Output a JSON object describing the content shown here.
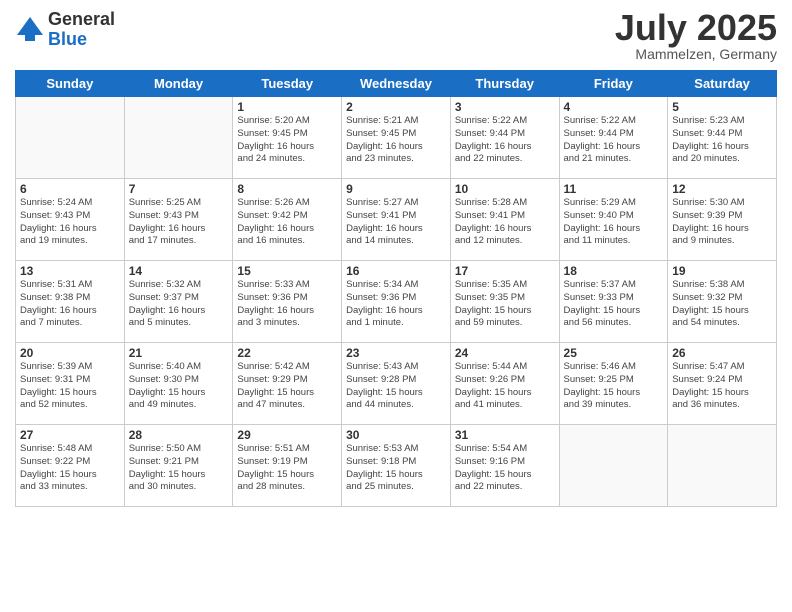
{
  "logo": {
    "general": "General",
    "blue": "Blue"
  },
  "title": "July 2025",
  "location": "Mammelzen, Germany",
  "days_of_week": [
    "Sunday",
    "Monday",
    "Tuesday",
    "Wednesday",
    "Thursday",
    "Friday",
    "Saturday"
  ],
  "weeks": [
    [
      {
        "day": null,
        "info": null
      },
      {
        "day": null,
        "info": null
      },
      {
        "day": "1",
        "info": "Sunrise: 5:20 AM\nSunset: 9:45 PM\nDaylight: 16 hours\nand 24 minutes."
      },
      {
        "day": "2",
        "info": "Sunrise: 5:21 AM\nSunset: 9:45 PM\nDaylight: 16 hours\nand 23 minutes."
      },
      {
        "day": "3",
        "info": "Sunrise: 5:22 AM\nSunset: 9:44 PM\nDaylight: 16 hours\nand 22 minutes."
      },
      {
        "day": "4",
        "info": "Sunrise: 5:22 AM\nSunset: 9:44 PM\nDaylight: 16 hours\nand 21 minutes."
      },
      {
        "day": "5",
        "info": "Sunrise: 5:23 AM\nSunset: 9:44 PM\nDaylight: 16 hours\nand 20 minutes."
      }
    ],
    [
      {
        "day": "6",
        "info": "Sunrise: 5:24 AM\nSunset: 9:43 PM\nDaylight: 16 hours\nand 19 minutes."
      },
      {
        "day": "7",
        "info": "Sunrise: 5:25 AM\nSunset: 9:43 PM\nDaylight: 16 hours\nand 17 minutes."
      },
      {
        "day": "8",
        "info": "Sunrise: 5:26 AM\nSunset: 9:42 PM\nDaylight: 16 hours\nand 16 minutes."
      },
      {
        "day": "9",
        "info": "Sunrise: 5:27 AM\nSunset: 9:41 PM\nDaylight: 16 hours\nand 14 minutes."
      },
      {
        "day": "10",
        "info": "Sunrise: 5:28 AM\nSunset: 9:41 PM\nDaylight: 16 hours\nand 12 minutes."
      },
      {
        "day": "11",
        "info": "Sunrise: 5:29 AM\nSunset: 9:40 PM\nDaylight: 16 hours\nand 11 minutes."
      },
      {
        "day": "12",
        "info": "Sunrise: 5:30 AM\nSunset: 9:39 PM\nDaylight: 16 hours\nand 9 minutes."
      }
    ],
    [
      {
        "day": "13",
        "info": "Sunrise: 5:31 AM\nSunset: 9:38 PM\nDaylight: 16 hours\nand 7 minutes."
      },
      {
        "day": "14",
        "info": "Sunrise: 5:32 AM\nSunset: 9:37 PM\nDaylight: 16 hours\nand 5 minutes."
      },
      {
        "day": "15",
        "info": "Sunrise: 5:33 AM\nSunset: 9:36 PM\nDaylight: 16 hours\nand 3 minutes."
      },
      {
        "day": "16",
        "info": "Sunrise: 5:34 AM\nSunset: 9:36 PM\nDaylight: 16 hours\nand 1 minute."
      },
      {
        "day": "17",
        "info": "Sunrise: 5:35 AM\nSunset: 9:35 PM\nDaylight: 15 hours\nand 59 minutes."
      },
      {
        "day": "18",
        "info": "Sunrise: 5:37 AM\nSunset: 9:33 PM\nDaylight: 15 hours\nand 56 minutes."
      },
      {
        "day": "19",
        "info": "Sunrise: 5:38 AM\nSunset: 9:32 PM\nDaylight: 15 hours\nand 54 minutes."
      }
    ],
    [
      {
        "day": "20",
        "info": "Sunrise: 5:39 AM\nSunset: 9:31 PM\nDaylight: 15 hours\nand 52 minutes."
      },
      {
        "day": "21",
        "info": "Sunrise: 5:40 AM\nSunset: 9:30 PM\nDaylight: 15 hours\nand 49 minutes."
      },
      {
        "day": "22",
        "info": "Sunrise: 5:42 AM\nSunset: 9:29 PM\nDaylight: 15 hours\nand 47 minutes."
      },
      {
        "day": "23",
        "info": "Sunrise: 5:43 AM\nSunset: 9:28 PM\nDaylight: 15 hours\nand 44 minutes."
      },
      {
        "day": "24",
        "info": "Sunrise: 5:44 AM\nSunset: 9:26 PM\nDaylight: 15 hours\nand 41 minutes."
      },
      {
        "day": "25",
        "info": "Sunrise: 5:46 AM\nSunset: 9:25 PM\nDaylight: 15 hours\nand 39 minutes."
      },
      {
        "day": "26",
        "info": "Sunrise: 5:47 AM\nSunset: 9:24 PM\nDaylight: 15 hours\nand 36 minutes."
      }
    ],
    [
      {
        "day": "27",
        "info": "Sunrise: 5:48 AM\nSunset: 9:22 PM\nDaylight: 15 hours\nand 33 minutes."
      },
      {
        "day": "28",
        "info": "Sunrise: 5:50 AM\nSunset: 9:21 PM\nDaylight: 15 hours\nand 30 minutes."
      },
      {
        "day": "29",
        "info": "Sunrise: 5:51 AM\nSunset: 9:19 PM\nDaylight: 15 hours\nand 28 minutes."
      },
      {
        "day": "30",
        "info": "Sunrise: 5:53 AM\nSunset: 9:18 PM\nDaylight: 15 hours\nand 25 minutes."
      },
      {
        "day": "31",
        "info": "Sunrise: 5:54 AM\nSunset: 9:16 PM\nDaylight: 15 hours\nand 22 minutes."
      },
      {
        "day": null,
        "info": null
      },
      {
        "day": null,
        "info": null
      }
    ]
  ]
}
